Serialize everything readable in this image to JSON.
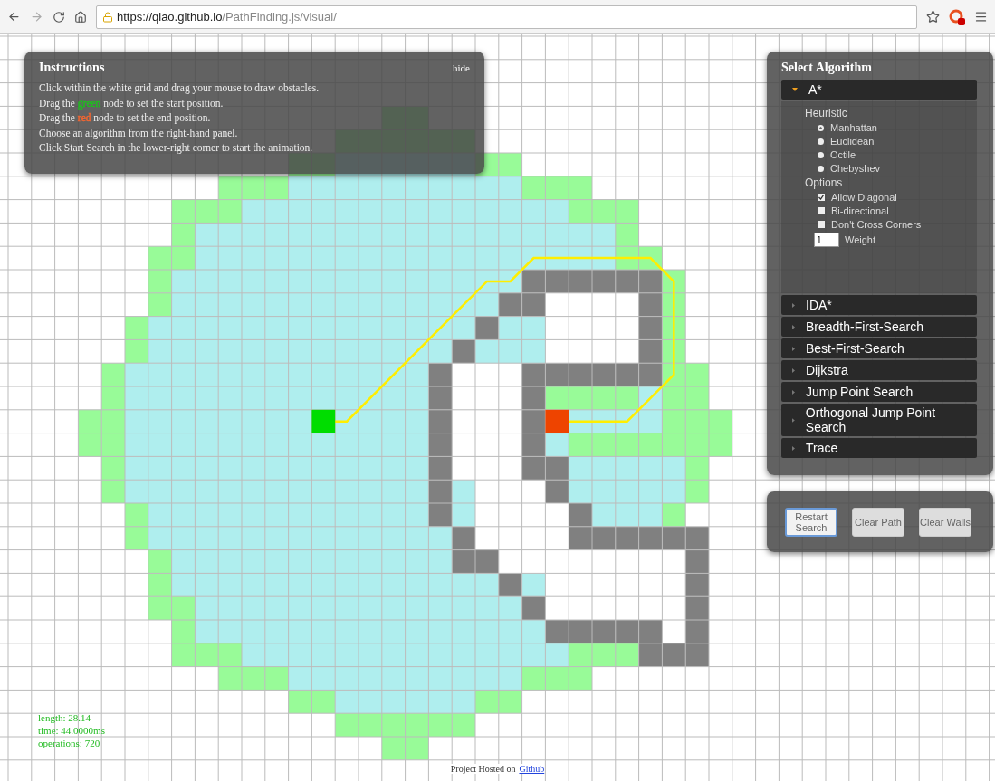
{
  "browser": {
    "url_host": "https://qiao.github.io",
    "url_path": "/PathFinding.js/visual/"
  },
  "instructions": {
    "title": "Instructions",
    "hide_link": "hide",
    "lines": [
      {
        "parts": [
          {
            "text": "Click within the white grid and drag your mouse to draw obstacles."
          }
        ]
      },
      {
        "parts": [
          {
            "text": "Drag the "
          },
          {
            "text": "green",
            "color": "#22bb22"
          },
          {
            "text": " node to set the start position."
          }
        ]
      },
      {
        "parts": [
          {
            "text": "Drag the "
          },
          {
            "text": "red",
            "color": "#ee6633"
          },
          {
            "text": " node to set the end position."
          }
        ]
      },
      {
        "parts": [
          {
            "text": "Choose an algorithm from the right-hand panel."
          }
        ]
      },
      {
        "parts": [
          {
            "text": "Click Start Search in the lower-right corner to start the animation."
          }
        ]
      }
    ]
  },
  "algorithm_panel": {
    "title": "Select Algorithm",
    "algorithms": [
      {
        "name": "A*",
        "expanded": true,
        "heuristic_label": "Heuristic",
        "heuristics": [
          {
            "label": "Manhattan",
            "selected": true
          },
          {
            "label": "Euclidean",
            "selected": false
          },
          {
            "label": "Octile",
            "selected": false
          },
          {
            "label": "Chebyshev",
            "selected": false
          }
        ],
        "options_label": "Options",
        "options": [
          {
            "label": "Allow Diagonal",
            "checked": true
          },
          {
            "label": "Bi-directional",
            "checked": false
          },
          {
            "label": "Don't Cross Corners",
            "checked": false
          }
        ],
        "weight": {
          "value": "1",
          "label": "Weight"
        }
      },
      {
        "name": "IDA*",
        "expanded": false
      },
      {
        "name": "Breadth-First-Search",
        "expanded": false
      },
      {
        "name": "Best-First-Search",
        "expanded": false
      },
      {
        "name": "Dijkstra",
        "expanded": false
      },
      {
        "name": "Jump Point Search",
        "expanded": false
      },
      {
        "name": "Orthogonal Jump Point Search",
        "expanded": false
      },
      {
        "name": "Trace",
        "expanded": false
      }
    ]
  },
  "controls": [
    {
      "label": "Restart Search",
      "focused": true
    },
    {
      "label": "Clear Path",
      "focused": false
    },
    {
      "label": "Clear Walls",
      "focused": false
    }
  ],
  "stats": [
    "length: 28.14",
    "time: 44.0000ms",
    "operations: 720"
  ],
  "footer": {
    "text": "Project Hosted on",
    "link": "Github"
  }
}
